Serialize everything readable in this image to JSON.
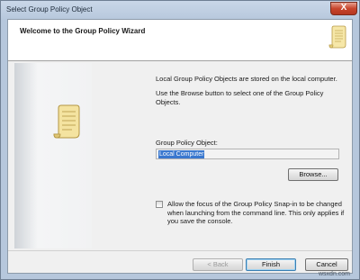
{
  "window": {
    "title": "Select Group Policy Object",
    "close_glyph": "X"
  },
  "wizard": {
    "header_title": "Welcome to the Group Policy Wizard",
    "header_icon": "scroll-icon",
    "side_icon": "scroll-icon",
    "info_paragraph_1": "Local Group Policy Objects are stored on the local computer.",
    "info_paragraph_2": "Use the Browse button to select one of the Group Policy Objects.",
    "gpo_label": "Group Policy Object:",
    "gpo_value": "Local Computer",
    "browse_label": "Browse...",
    "checkbox_checked": false,
    "checkbox_label": "Allow the focus of the Group Policy Snap-in to be changed when launching from the command line.  This only applies if you save the console."
  },
  "footer": {
    "back_label": "< Back",
    "finish_label": "Finish",
    "cancel_label": "Cancel"
  },
  "watermark": "wsxdn.com",
  "colors": {
    "selection": "#3a78cf",
    "close_button": "#c8452c",
    "window_frame": "#b6c7dc"
  }
}
